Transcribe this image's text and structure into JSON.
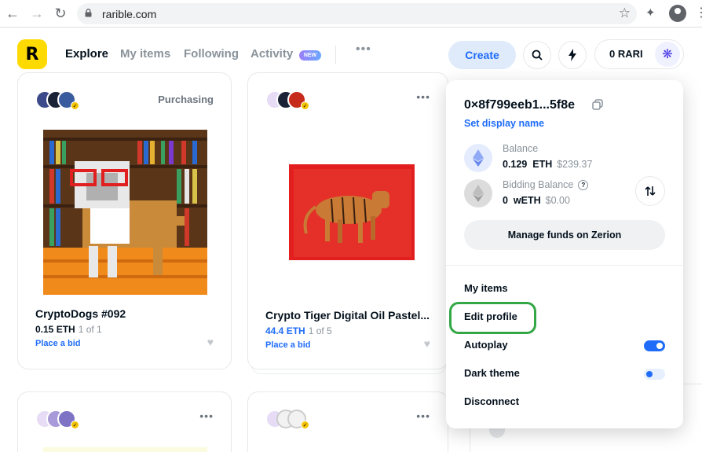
{
  "browser": {
    "url": "rarible.com"
  },
  "header": {
    "logo": "R",
    "nav": [
      "Explore",
      "My items",
      "Following",
      "Activity"
    ],
    "new_badge": "NEW",
    "more": "•••",
    "create_label": "Create",
    "rari_balance": "0 RARI"
  },
  "cards": [
    {
      "status": "Purchasing",
      "title": "CryptoDogs #092",
      "price": "0.15 ETH",
      "edition": "1 of 1",
      "action": "Place a bid"
    },
    {
      "title": "Crypto Tiger Digital Oil Pastel...",
      "price": "44.4 ETH",
      "edition": "1 of 5",
      "action": "Place a bid"
    }
  ],
  "account_menu": {
    "address": "0×8f799eeb1...5f8e",
    "set_display_name": "Set display name",
    "balance": {
      "label": "Balance",
      "amount": "0.129",
      "unit": "ETH",
      "usd": "$239.37"
    },
    "bidding_balance": {
      "label": "Bidding Balance",
      "help": "?",
      "amount": "0",
      "unit": "wETH",
      "usd": "$0.00"
    },
    "manage_funds": "Manage funds on Zerion",
    "items": [
      "My items",
      "Edit profile",
      "Autoplay",
      "Dark theme",
      "Disconnect"
    ],
    "autoplay_on": true,
    "dark_theme_on": false
  },
  "colors": {
    "accent_blue": "#1f6cf9",
    "brand_yellow": "#feda03",
    "highlight_green": "#33a645"
  }
}
